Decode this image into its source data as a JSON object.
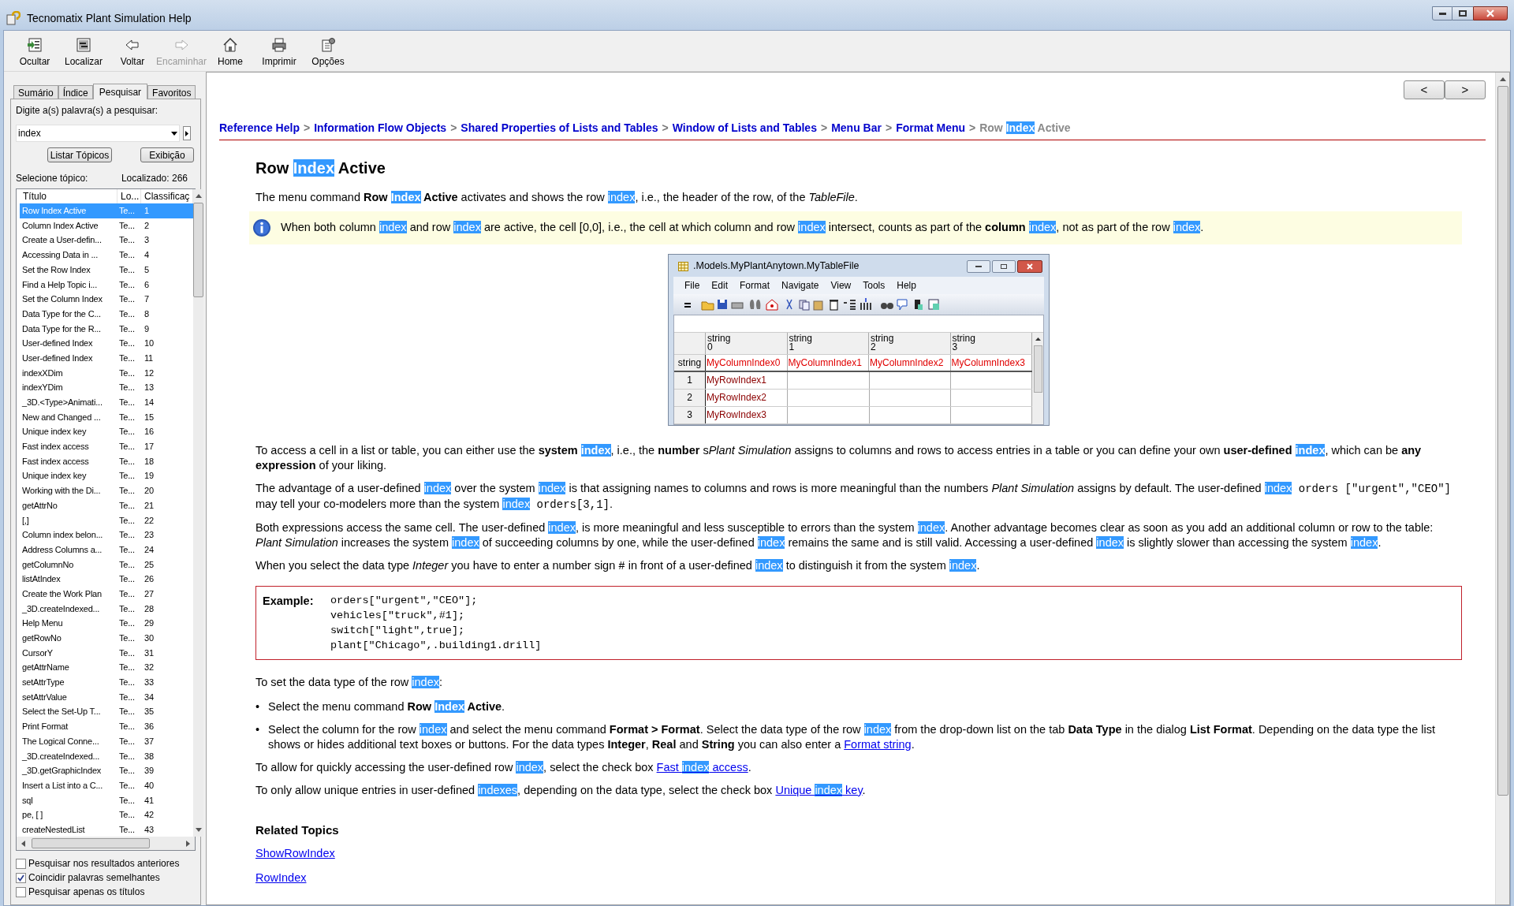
{
  "window": {
    "title": "Tecnomatix Plant Simulation Help"
  },
  "toolbar": [
    {
      "label": "Ocultar",
      "kind": "hide",
      "disabled": false
    },
    {
      "label": "Localizar",
      "kind": "locate",
      "disabled": false
    },
    {
      "label": "Voltar",
      "kind": "back",
      "disabled": false
    },
    {
      "label": "Encaminhar",
      "kind": "forward",
      "disabled": true
    },
    {
      "label": "Home",
      "kind": "home",
      "disabled": false
    },
    {
      "label": "Imprimir",
      "kind": "print",
      "disabled": false
    },
    {
      "label": "Opções",
      "kind": "options",
      "disabled": false
    }
  ],
  "sidebar": {
    "tabs": [
      {
        "label": "Sumário",
        "selected": false
      },
      {
        "label": "Índice",
        "selected": false
      },
      {
        "label": "Pesquisar",
        "selected": true
      },
      {
        "label": "Favoritos",
        "selected": false
      }
    ],
    "search_label": "Digite a(s) palavra(s) a pesquisar:",
    "search_value": "index",
    "buttons": [
      "Listar Tópicos",
      "Exibição"
    ],
    "select_label": "Selecione tópico:",
    "found": "Localizado: 266",
    "columns": [
      "Título",
      "Lo...",
      "Classificaç"
    ],
    "rows": [
      {
        "title": "Row Index Active",
        "location": "Te...",
        "rank": "1",
        "selected": true
      },
      {
        "title": "Column Index Active",
        "location": "Te...",
        "rank": "2",
        "selected": false
      },
      {
        "title": "Create a User-defin...",
        "location": "Te...",
        "rank": "3",
        "selected": false
      },
      {
        "title": "Accessing Data in ...",
        "location": "Te...",
        "rank": "4",
        "selected": false
      },
      {
        "title": "Set the Row Index",
        "location": "Te...",
        "rank": "5",
        "selected": false
      },
      {
        "title": "Find a Help Topic i...",
        "location": "Te...",
        "rank": "6",
        "selected": false
      },
      {
        "title": "Set the Column Index",
        "location": "Te...",
        "rank": "7",
        "selected": false
      },
      {
        "title": "Data Type for the C...",
        "location": "Te...",
        "rank": "8",
        "selected": false
      },
      {
        "title": "Data Type for the R...",
        "location": "Te...",
        "rank": "9",
        "selected": false
      },
      {
        "title": "User-defined Index",
        "location": "Te...",
        "rank": "10",
        "selected": false
      },
      {
        "title": "User-defined Index",
        "location": "Te...",
        "rank": "11",
        "selected": false
      },
      {
        "title": "indexXDim",
        "location": "Te...",
        "rank": "12",
        "selected": false
      },
      {
        "title": "indexYDim",
        "location": "Te...",
        "rank": "13",
        "selected": false
      },
      {
        "title": "_3D.<Type>Animati...",
        "location": "Te...",
        "rank": "14",
        "selected": false
      },
      {
        "title": "New and Changed ...",
        "location": "Te...",
        "rank": "15",
        "selected": false
      },
      {
        "title": "Unique index key",
        "location": "Te...",
        "rank": "16",
        "selected": false
      },
      {
        "title": "Fast index access",
        "location": "Te...",
        "rank": "17",
        "selected": false
      },
      {
        "title": "Fast index access",
        "location": "Te...",
        "rank": "18",
        "selected": false
      },
      {
        "title": "Unique index key",
        "location": "Te...",
        "rank": "19",
        "selected": false
      },
      {
        "title": "Working with the Di...",
        "location": "Te...",
        "rank": "20",
        "selected": false
      },
      {
        "title": "getAttrNo",
        "location": "Te...",
        "rank": "21",
        "selected": false
      },
      {
        "title": "[,]",
        "location": "Te...",
        "rank": "22",
        "selected": false
      },
      {
        "title": "Column index belon...",
        "location": "Te...",
        "rank": "23",
        "selected": false
      },
      {
        "title": "Address Columns a...",
        "location": "Te...",
        "rank": "24",
        "selected": false
      },
      {
        "title": "getColumnNo",
        "location": "Te...",
        "rank": "25",
        "selected": false
      },
      {
        "title": "listAtIndex",
        "location": "Te...",
        "rank": "26",
        "selected": false
      },
      {
        "title": "Create the Work Plan",
        "location": "Te...",
        "rank": "27",
        "selected": false
      },
      {
        "title": "_3D.createIndexed...",
        "location": "Te...",
        "rank": "28",
        "selected": false
      },
      {
        "title": "Help Menu",
        "location": "Te...",
        "rank": "29",
        "selected": false
      },
      {
        "title": "getRowNo",
        "location": "Te...",
        "rank": "30",
        "selected": false
      },
      {
        "title": "CursorY",
        "location": "Te...",
        "rank": "31",
        "selected": false
      },
      {
        "title": "getAttrName",
        "location": "Te...",
        "rank": "32",
        "selected": false
      },
      {
        "title": "setAttrType",
        "location": "Te...",
        "rank": "33",
        "selected": false
      },
      {
        "title": "setAttrValue",
        "location": "Te...",
        "rank": "34",
        "selected": false
      },
      {
        "title": "Select the Set-Up T...",
        "location": "Te...",
        "rank": "35",
        "selected": false
      },
      {
        "title": "Print Format",
        "location": "Te...",
        "rank": "36",
        "selected": false
      },
      {
        "title": "The Logical Conne...",
        "location": "Te...",
        "rank": "37",
        "selected": false
      },
      {
        "title": "_3D.createIndexed...",
        "location": "Te...",
        "rank": "38",
        "selected": false
      },
      {
        "title": "_3D.getGraphicIndex",
        "location": "Te...",
        "rank": "39",
        "selected": false
      },
      {
        "title": "Insert a List into a C...",
        "location": "Te...",
        "rank": "40",
        "selected": false
      },
      {
        "title": "sql",
        "location": "Te...",
        "rank": "41",
        "selected": false
      },
      {
        "title": "pe, [ ]",
        "location": "Te...",
        "rank": "42",
        "selected": false
      },
      {
        "title": "createNestedList",
        "location": "Te...",
        "rank": "43",
        "selected": false
      }
    ],
    "options": [
      {
        "label": "Pesquisar nos resultados anteriores",
        "checked": false
      },
      {
        "label": "Coincidir palavras semelhantes",
        "checked": true
      },
      {
        "label": "Pesquisar apenas os títulos",
        "checked": false
      }
    ]
  },
  "nav_buttons": [
    "<",
    ">"
  ],
  "breadcrumb": [
    {
      "kind": "link",
      "text": "Reference Help"
    },
    {
      "kind": "sep",
      "text": ">"
    },
    {
      "kind": "link",
      "text": "Information Flow Objects"
    },
    {
      "kind": "sep",
      "text": ">"
    },
    {
      "kind": "link",
      "text": "Shared Properties of Lists and Tables"
    },
    {
      "kind": "sep",
      "text": ">"
    },
    {
      "kind": "link",
      "text": "Window of Lists and Tables"
    },
    {
      "kind": "sep",
      "text": ">"
    },
    {
      "kind": "link",
      "text": "Menu Bar"
    },
    {
      "kind": "sep",
      "text": ">"
    },
    {
      "kind": "link",
      "text": "Format Menu"
    },
    {
      "kind": "sep",
      "text": ">"
    },
    {
      "kind": "current",
      "parts": [
        {
          "kind": "text",
          "text": "Row "
        },
        {
          "kind": "hl",
          "text": "Index"
        },
        {
          "kind": "text",
          "text": " Active"
        }
      ]
    }
  ],
  "heading": [
    {
      "kind": "text",
      "text": "Row "
    },
    {
      "kind": "hl",
      "text": "Index"
    },
    {
      "kind": "text",
      "text": " Active"
    }
  ],
  "intro": [
    {
      "kind": "text",
      "text": "The menu command "
    },
    {
      "kind": "bold",
      "text": "Row "
    },
    {
      "kind": "bold-hl",
      "text": "Index"
    },
    {
      "kind": "bold",
      "text": " Active"
    },
    {
      "kind": "text",
      "text": " activates and shows the row "
    },
    {
      "kind": "hl",
      "text": "index"
    },
    {
      "kind": "text",
      "text": ", i.e., the header of the row, of the "
    },
    {
      "kind": "italic",
      "text": "TableFile"
    },
    {
      "kind": "text",
      "text": "."
    }
  ],
  "note": [
    {
      "kind": "text",
      "text": "When both column "
    },
    {
      "kind": "hl",
      "text": "index"
    },
    {
      "kind": "text",
      "text": " and row "
    },
    {
      "kind": "hl",
      "text": "index"
    },
    {
      "kind": "text",
      "text": " are active, the cell [0,0], i.e., the cell at which column and row "
    },
    {
      "kind": "hl",
      "text": "index"
    },
    {
      "kind": "text",
      "text": " intersect, counts as part of the "
    },
    {
      "kind": "bold",
      "text": "column "
    },
    {
      "kind": "hl",
      "text": "index"
    },
    {
      "kind": "text",
      "text": ", not as part of the row "
    },
    {
      "kind": "hl",
      "text": "index"
    },
    {
      "kind": "text",
      "text": "."
    }
  ],
  "figure": {
    "title": ".Models.MyPlantAnytown.MyTableFile",
    "menu": [
      "File",
      "Edit",
      "Format",
      "Navigate",
      "View",
      "Tools",
      "Help"
    ],
    "header_type": "string",
    "columns": [
      {
        "type": "string",
        "index": "0"
      },
      {
        "type": "string",
        "index": "1"
      },
      {
        "type": "string",
        "index": "2"
      },
      {
        "type": "string",
        "index": "3"
      }
    ],
    "column_names": [
      "MyColumnIndex0",
      "MyColumnIndex1",
      "MyColumnIndex2",
      "MyColumnIndex3"
    ],
    "rows": [
      {
        "number": "1",
        "name": "MyRowIndex1"
      },
      {
        "number": "2",
        "name": "MyRowIndex2"
      },
      {
        "number": "3",
        "name": "MyRowIndex3"
      }
    ]
  },
  "paragraphs_a": [
    [
      {
        "kind": "text",
        "text": "To access a cell in a list or table, you can either use the "
      },
      {
        "kind": "bold",
        "text": "system "
      },
      {
        "kind": "bold-hl",
        "text": "index"
      },
      {
        "kind": "text",
        "text": ", i.e., the "
      },
      {
        "kind": "bold",
        "text": "number"
      },
      {
        "kind": "text",
        "text": " s"
      },
      {
        "kind": "italic",
        "text": "Plant Simulation"
      },
      {
        "kind": "text",
        "text": " assigns to columns and rows to access entries in a table or you can define your own "
      },
      {
        "kind": "bold",
        "text": "user-defined "
      },
      {
        "kind": "bold-hl",
        "text": "index"
      },
      {
        "kind": "text",
        "text": ", which can be "
      },
      {
        "kind": "bold",
        "text": "any expression"
      },
      {
        "kind": "text",
        "text": " of your liking."
      }
    ],
    [
      {
        "kind": "text",
        "text": "The advantage of a user-defined "
      },
      {
        "kind": "hl",
        "text": "index"
      },
      {
        "kind": "text",
        "text": " over the system "
      },
      {
        "kind": "hl",
        "text": "index"
      },
      {
        "kind": "text",
        "text": " is that assigning names to columns and rows is more meaningful than the numbers "
      },
      {
        "kind": "italic",
        "text": "Plant Simulation"
      },
      {
        "kind": "text",
        "text": " assigns by default. The user-defined "
      },
      {
        "kind": "hl",
        "text": "index"
      },
      {
        "kind": "code",
        "text": " orders [\"urgent\",\"CEO\"]"
      },
      {
        "kind": "text",
        "text": " may tell your co-modelers more than the system "
      },
      {
        "kind": "hl",
        "text": "index"
      },
      {
        "kind": "code",
        "text": " orders[3,1]"
      },
      {
        "kind": "text",
        "text": "."
      }
    ],
    [
      {
        "kind": "text",
        "text": "Both expressions access the same cell. The user-defined "
      },
      {
        "kind": "hl",
        "text": "index"
      },
      {
        "kind": "text",
        "text": ", is more meaningful and less susceptible to errors than the system "
      },
      {
        "kind": "hl",
        "text": "index"
      },
      {
        "kind": "text",
        "text": ". Another advantage becomes clear as soon as you add an additional column or row to the table: "
      },
      {
        "kind": "italic",
        "text": "Plant Simulation"
      },
      {
        "kind": "text",
        "text": " increases the system "
      },
      {
        "kind": "hl",
        "text": "index"
      },
      {
        "kind": "text",
        "text": " of succeeding columns by one, while the user-defined "
      },
      {
        "kind": "hl",
        "text": "index"
      },
      {
        "kind": "text",
        "text": " remains the same and is still valid. Accessing a user-defined "
      },
      {
        "kind": "hl",
        "text": "index"
      },
      {
        "kind": "text",
        "text": " is slightly slower than accessing the system "
      },
      {
        "kind": "hl",
        "text": "index"
      },
      {
        "kind": "text",
        "text": "."
      }
    ],
    [
      {
        "kind": "text",
        "text": "When you select the data type "
      },
      {
        "kind": "italic",
        "text": "Integer"
      },
      {
        "kind": "text",
        "text": " you have to enter a number sign "
      },
      {
        "kind": "code",
        "text": "#"
      },
      {
        "kind": "text",
        "text": " in front of a user-defined "
      },
      {
        "kind": "hl",
        "text": "index"
      },
      {
        "kind": "text",
        "text": " to distinguish it from the system "
      },
      {
        "kind": "hl",
        "text": "index"
      },
      {
        "kind": "text",
        "text": "."
      }
    ]
  ],
  "example": {
    "label": "Example:",
    "lines": [
      "orders[\"urgent\",\"CEO\"];",
      "vehicles[\"truck\",#1];",
      "switch[\"light\",true];",
      "plant[\"Chicago\",.building1.drill]"
    ]
  },
  "steps_intro": [
    {
      "kind": "text",
      "text": "To set the data type of the row "
    },
    {
      "kind": "hl",
      "text": "index"
    },
    {
      "kind": "text",
      "text": ":"
    }
  ],
  "bullets": [
    {
      "marker": "•",
      "parts": [
        {
          "kind": "text",
          "text": "Select the menu command "
        },
        {
          "kind": "bold",
          "text": "Row "
        },
        {
          "kind": "bold-hl",
          "text": "Index"
        },
        {
          "kind": "bold",
          "text": " Active"
        },
        {
          "kind": "text",
          "text": "."
        }
      ]
    },
    {
      "marker": "•",
      "parts": [
        {
          "kind": "text",
          "text": "Select the column for the row "
        },
        {
          "kind": "hl",
          "text": "index"
        },
        {
          "kind": "text",
          "text": " and select the menu command "
        },
        {
          "kind": "bold",
          "text": "Format > Format"
        },
        {
          "kind": "text",
          "text": ". Select the data type of the row "
        },
        {
          "kind": "hl",
          "text": "index"
        },
        {
          "kind": "text",
          "text": " from the drop-down list on the tab "
        },
        {
          "kind": "bold",
          "text": "Data Type"
        },
        {
          "kind": "text",
          "text": " in the dialog "
        },
        {
          "kind": "bold",
          "text": "List Format"
        },
        {
          "kind": "text",
          "text": ". Depending on the data type the list shows or hides additional text boxes or buttons. For the data types "
        },
        {
          "kind": "bold",
          "text": "Integer"
        },
        {
          "kind": "text",
          "text": ", "
        },
        {
          "kind": "bold",
          "text": "Real"
        },
        {
          "kind": "text",
          "text": " and "
        },
        {
          "kind": "bold",
          "text": "String"
        },
        {
          "kind": "text",
          "text": " you can also enter a "
        },
        {
          "kind": "link",
          "parts": [
            {
              "kind": "text",
              "text": "Format string"
            }
          ]
        },
        {
          "kind": "text",
          "text": "."
        }
      ]
    }
  ],
  "paragraphs_b": [
    [
      {
        "kind": "text",
        "text": "To allow for quickly accessing the user-defined row "
      },
      {
        "kind": "hl",
        "text": "index"
      },
      {
        "kind": "text",
        "text": ", select the check box "
      },
      {
        "kind": "link",
        "parts": [
          {
            "kind": "text",
            "text": "Fast "
          },
          {
            "kind": "hl",
            "text": "index"
          },
          {
            "kind": "text",
            "text": " access"
          }
        ]
      },
      {
        "kind": "text",
        "text": "."
      }
    ],
    [
      {
        "kind": "text",
        "text": "To only allow unique entries in user-defined "
      },
      {
        "kind": "hl",
        "text": "indexes"
      },
      {
        "kind": "text",
        "text": ", depending on the data type, select the check box "
      },
      {
        "kind": "link",
        "parts": [
          {
            "kind": "text",
            "text": "Unique "
          },
          {
            "kind": "hl",
            "text": "index"
          },
          {
            "kind": "text",
            "text": " key"
          }
        ]
      },
      {
        "kind": "text",
        "text": "."
      }
    ]
  ],
  "related": {
    "title": "Related Topics",
    "links": [
      "ShowRowIndex",
      "RowIndex"
    ]
  }
}
